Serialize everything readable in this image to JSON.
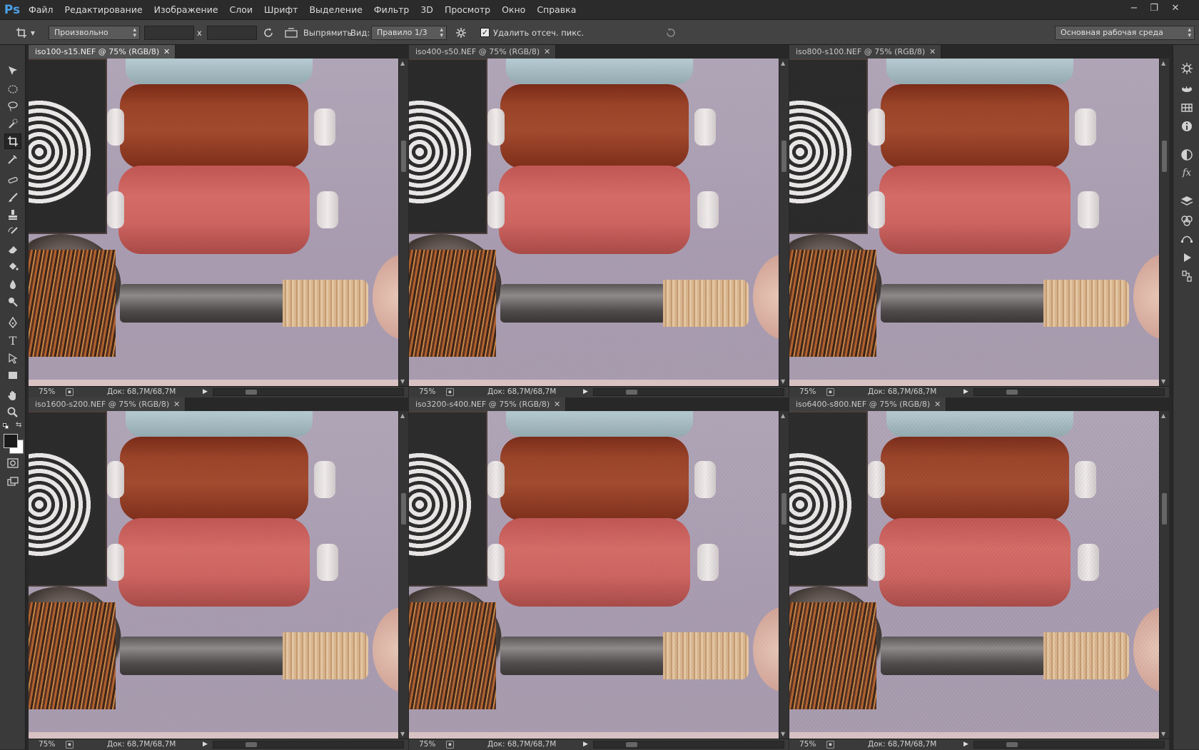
{
  "app": {
    "logo": "Ps",
    "menu": [
      "Файл",
      "Редактирование",
      "Изображение",
      "Слои",
      "Шрифт",
      "Выделение",
      "Фильтр",
      "3D",
      "Просмотр",
      "Окно",
      "Справка"
    ],
    "window_controls": {
      "minimize": "−",
      "restore": "❐",
      "close": "✕"
    }
  },
  "options_bar": {
    "ratio_select": "Произвольно",
    "x_separator": "x",
    "straighten_label": "Выпрямить",
    "view_label": "Вид:",
    "view_select": "Правило 1/3",
    "delete_cropped_label": "Удалить отсеч. пикс.",
    "delete_cropped_checked": true,
    "workspace_select": "Основная рабочая среда"
  },
  "documents": [
    {
      "title": "iso100-s15.NEF @ 75% (RGB/8)",
      "zoom": "75%",
      "doc_size": "Док: 68,7M/68,7M",
      "active": true,
      "noise": 0
    },
    {
      "title": "iso400-s50.NEF @ 75% (RGB/8)",
      "zoom": "75%",
      "doc_size": "Док: 68,7M/68,7M",
      "active": false,
      "noise": 0.15
    },
    {
      "title": "iso800-s100.NEF @ 75% (RGB/8)",
      "zoom": "75%",
      "doc_size": "Док: 68,7M/68,7M",
      "active": false,
      "noise": 0.3
    },
    {
      "title": "iso1600-s200.NEF @ 75% (RGB/8)",
      "zoom": "75%",
      "doc_size": "Док: 68,7M/68,7M",
      "active": false,
      "noise": 0.45
    },
    {
      "title": "iso3200-s400.NEF @ 75% (RGB/8)",
      "zoom": "75%",
      "doc_size": "Док: 68,7M/68,7M",
      "active": false,
      "noise": 0.65
    },
    {
      "title": "iso6400-s800.NEF @ 75% (RGB/8)",
      "zoom": "75%",
      "doc_size": "Док: 68,7M/68,7M",
      "active": false,
      "noise": 0.9
    }
  ],
  "tools": [
    "move-icon",
    "marquee-icon",
    "lasso-icon",
    "quick-select-icon",
    "crop-icon",
    "eyedropper-icon",
    "healing-icon",
    "brush-icon",
    "stamp-icon",
    "history-brush-icon",
    "eraser-icon",
    "paint-bucket-icon",
    "blur-icon",
    "dodge-icon",
    "pen-icon",
    "type-icon",
    "path-select-icon",
    "rectangle-icon",
    "hand-icon",
    "zoom-icon"
  ],
  "type_tool_glyph": "T",
  "panels": [
    "navigator-icon",
    "3d-icon",
    "swatches-icon",
    "info-icon",
    "adjustments-icon",
    "styles-icon",
    "layers-icon",
    "channels-icon",
    "paths-icon",
    "actions-icon",
    "history-icon"
  ],
  "styles_glyph": "fx",
  "colors": {
    "foreground": "#1a1a1a",
    "background": "#ffffff",
    "accent": "#4aa0e6"
  }
}
